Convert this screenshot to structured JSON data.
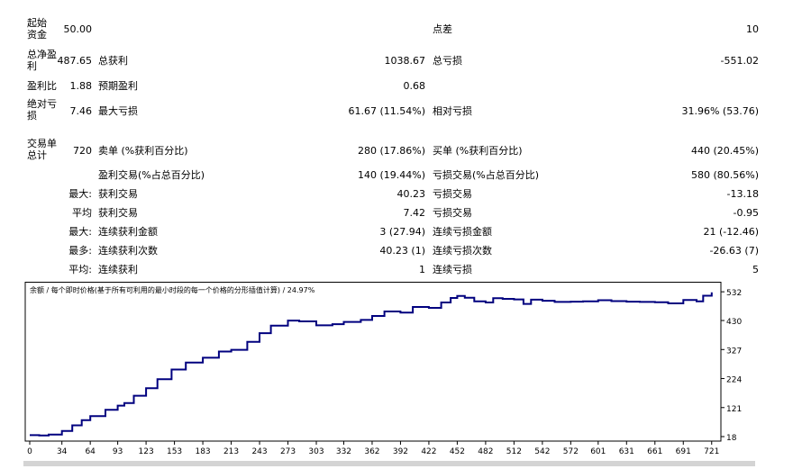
{
  "stats": {
    "initial_deposit": {
      "label": "起始资金",
      "value": "50.00"
    },
    "spread": {
      "label": "点差",
      "value": "10"
    },
    "total_net_profit": {
      "label": "总净盈利",
      "value": "487.65"
    },
    "gross_profit": {
      "label": "总获利",
      "value": "1038.67"
    },
    "gross_loss": {
      "label": "总亏损",
      "value": "-551.02"
    },
    "profit_factor": {
      "label": "盈利比",
      "value": "1.88"
    },
    "expected_payoff": {
      "label": "预期盈利",
      "value": "0.68"
    },
    "absolute_drawdown": {
      "label": "绝对亏损",
      "value": "7.46"
    },
    "maximal_drawdown": {
      "label": "最大亏损",
      "value": "61.67 (11.54%)"
    },
    "relative_drawdown": {
      "label": "相对亏损",
      "value": "31.96% (53.76)"
    },
    "total_trades": {
      "label": "交易单总计",
      "value": "720"
    },
    "short_positions": {
      "label": "卖单 (%获利百分比)",
      "value": "280 (17.86%)"
    },
    "long_positions": {
      "label": "买单 (%获利百分比)",
      "value": "440 (20.45%)"
    },
    "profit_trades": {
      "label": "盈利交易(%占总百分比)",
      "value": "140 (19.44%)"
    },
    "loss_trades": {
      "label": "亏损交易(%占总百分比)",
      "value": "580 (80.56%)"
    },
    "largest": {
      "prefix": "最大:",
      "profit_label": "获利交易",
      "profit_value": "40.23",
      "loss_label": "亏损交易",
      "loss_value": "-13.18"
    },
    "average": {
      "prefix": "平均",
      "profit_label": "获利交易",
      "profit_value": "7.42",
      "loss_label": "亏损交易",
      "loss_value": "-0.95"
    },
    "max_consecutive": {
      "prefix": "最大:",
      "wins_label": "连续获利金额",
      "wins_value": "3 (27.94)",
      "losses_label": "连续亏损金额",
      "losses_value": "21 (-12.46)"
    },
    "maximal_consecutive": {
      "prefix": "最多:",
      "profit_label": "连续获利次数",
      "profit_value": "40.23 (1)",
      "loss_label": "连续亏损次数",
      "loss_value": "-26.63 (7)"
    },
    "average_consecutive": {
      "prefix": "平均:",
      "wins_label": "连续获利",
      "wins_value": "1",
      "losses_label": "连续亏损",
      "losses_value": "5"
    }
  },
  "chart_data": {
    "type": "line",
    "title": "余额 / 每个即时价格(基于所有可利用的最小时段的每一个价格的分形插值计算) / 24.97%",
    "series": [
      {
        "color": "#00007f",
        "x": [
          0,
          10,
          20,
          34,
          45,
          55,
          64,
          70,
          80,
          93,
          100,
          110,
          123,
          135,
          150,
          165,
          183,
          200,
          213,
          230,
          243,
          255,
          273,
          285,
          303,
          320,
          332,
          350,
          362,
          375,
          392,
          405,
          422,
          435,
          445,
          452,
          460,
          470,
          482,
          490,
          500,
          512,
          522,
          530,
          542,
          555,
          572,
          585,
          601,
          615,
          631,
          645,
          661,
          675,
          691,
          705,
          712,
          721
        ],
        "y": [
          23,
          22,
          25,
          38,
          58,
          76,
          91,
          91,
          113,
          128,
          137,
          163,
          190,
          222,
          256,
          281,
          298,
          320,
          326,
          354,
          385,
          412,
          430,
          427,
          413,
          417,
          425,
          432,
          446,
          462,
          458,
          478,
          475,
          494,
          510,
          517,
          511,
          498,
          494,
          509,
          507,
          505,
          489,
          504,
          500,
          496,
          497,
          498,
          502,
          499,
          497,
          496,
          495,
          491,
          503,
          498,
          518,
          530
        ]
      }
    ],
    "x_ticks": [
      "0",
      "34",
      "64",
      "93",
      "123",
      "153",
      "183",
      "213",
      "243",
      "273",
      "303",
      "332",
      "362",
      "392",
      "422",
      "452",
      "482",
      "512",
      "542",
      "572",
      "601",
      "631",
      "661",
      "691",
      "721"
    ],
    "y_ticks": [
      "18",
      "121",
      "224",
      "327",
      "430",
      "532"
    ],
    "xlim": [
      0,
      726
    ],
    "ylim": [
      18,
      550
    ],
    "grid": false,
    "legend": "none"
  }
}
